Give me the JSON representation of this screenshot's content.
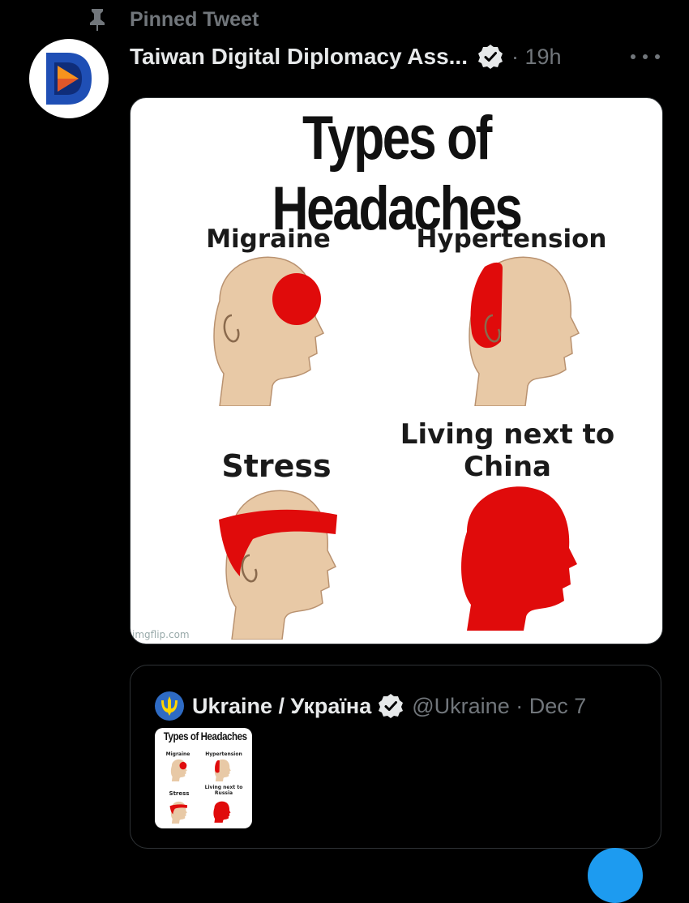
{
  "pinned": {
    "label": "Pinned Tweet"
  },
  "tweet": {
    "author_name": "Taiwan Digital Diplomacy Ass...",
    "time": "· 19h",
    "avatar_letter": "D",
    "more_label": "More"
  },
  "meme": {
    "title": "Types of Headaches",
    "captions": [
      "Migraine",
      "Hypertension",
      "Stress",
      "Living next to China"
    ],
    "watermark": "imgflip.com"
  },
  "quote": {
    "author_name": "Ukraine / Україна",
    "handle_time": "@Ukraine · Dec 7",
    "thumb": {
      "title": "Types of Headaches",
      "captions": [
        "Migraine",
        "Hypertension",
        "Stress",
        "Living next to Russia"
      ]
    }
  },
  "colors": {
    "background": "#000000",
    "muted_text": "#71767b",
    "verified_badge": "#e7e9ea",
    "pain_red": "#e00b0b",
    "skin": "#e8c9a6",
    "accent_blue": "#1d9bf0"
  },
  "icons": {
    "pin": "pin-icon",
    "verified": "verified-badge-icon",
    "more": "more-icon",
    "avatar": "taiwan-digital-diplomacy-logo"
  }
}
